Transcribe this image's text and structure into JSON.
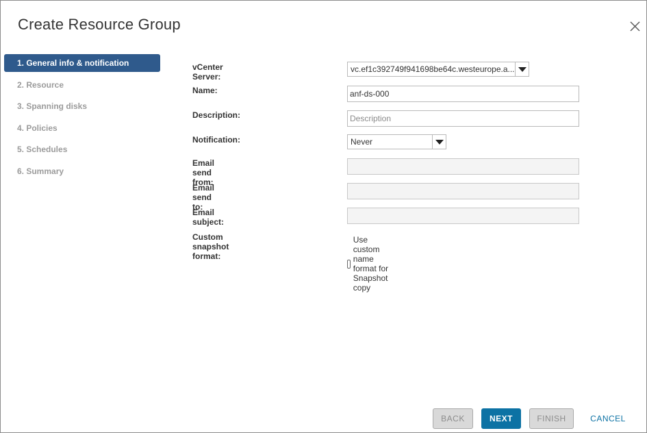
{
  "dialog": {
    "title": "Create Resource Group"
  },
  "steps": [
    {
      "label": "1. General info & notification",
      "active": true
    },
    {
      "label": "2. Resource",
      "active": false
    },
    {
      "label": "3. Spanning disks",
      "active": false
    },
    {
      "label": "4. Policies",
      "active": false
    },
    {
      "label": "5. Schedules",
      "active": false
    },
    {
      "label": "6. Summary",
      "active": false
    }
  ],
  "form": {
    "vcenter_label": "vCenter Server:",
    "vcenter_value": "vc.ef1c392749f941698be64c.westeurope.a...",
    "name_label": "Name:",
    "name_value": "anf-ds-000",
    "description_label": "Description:",
    "description_placeholder": "Description",
    "notification_label": "Notification:",
    "notification_value": "Never",
    "email_from_label": "Email send from:",
    "email_to_label": "Email send to:",
    "email_subject_label": "Email subject:",
    "snapshot_format_label": "Custom snapshot format:",
    "snapshot_checkbox_label": "Use custom name format for Snapshot copy"
  },
  "buttons": {
    "back": "BACK",
    "next": "NEXT",
    "finish": "FINISH",
    "cancel": "CANCEL"
  },
  "icons": {
    "close": "close-icon",
    "dropdown": "chevron-down-icon"
  },
  "colors": {
    "accent": "#0c72a4",
    "active_step": "#2f5a8c"
  }
}
